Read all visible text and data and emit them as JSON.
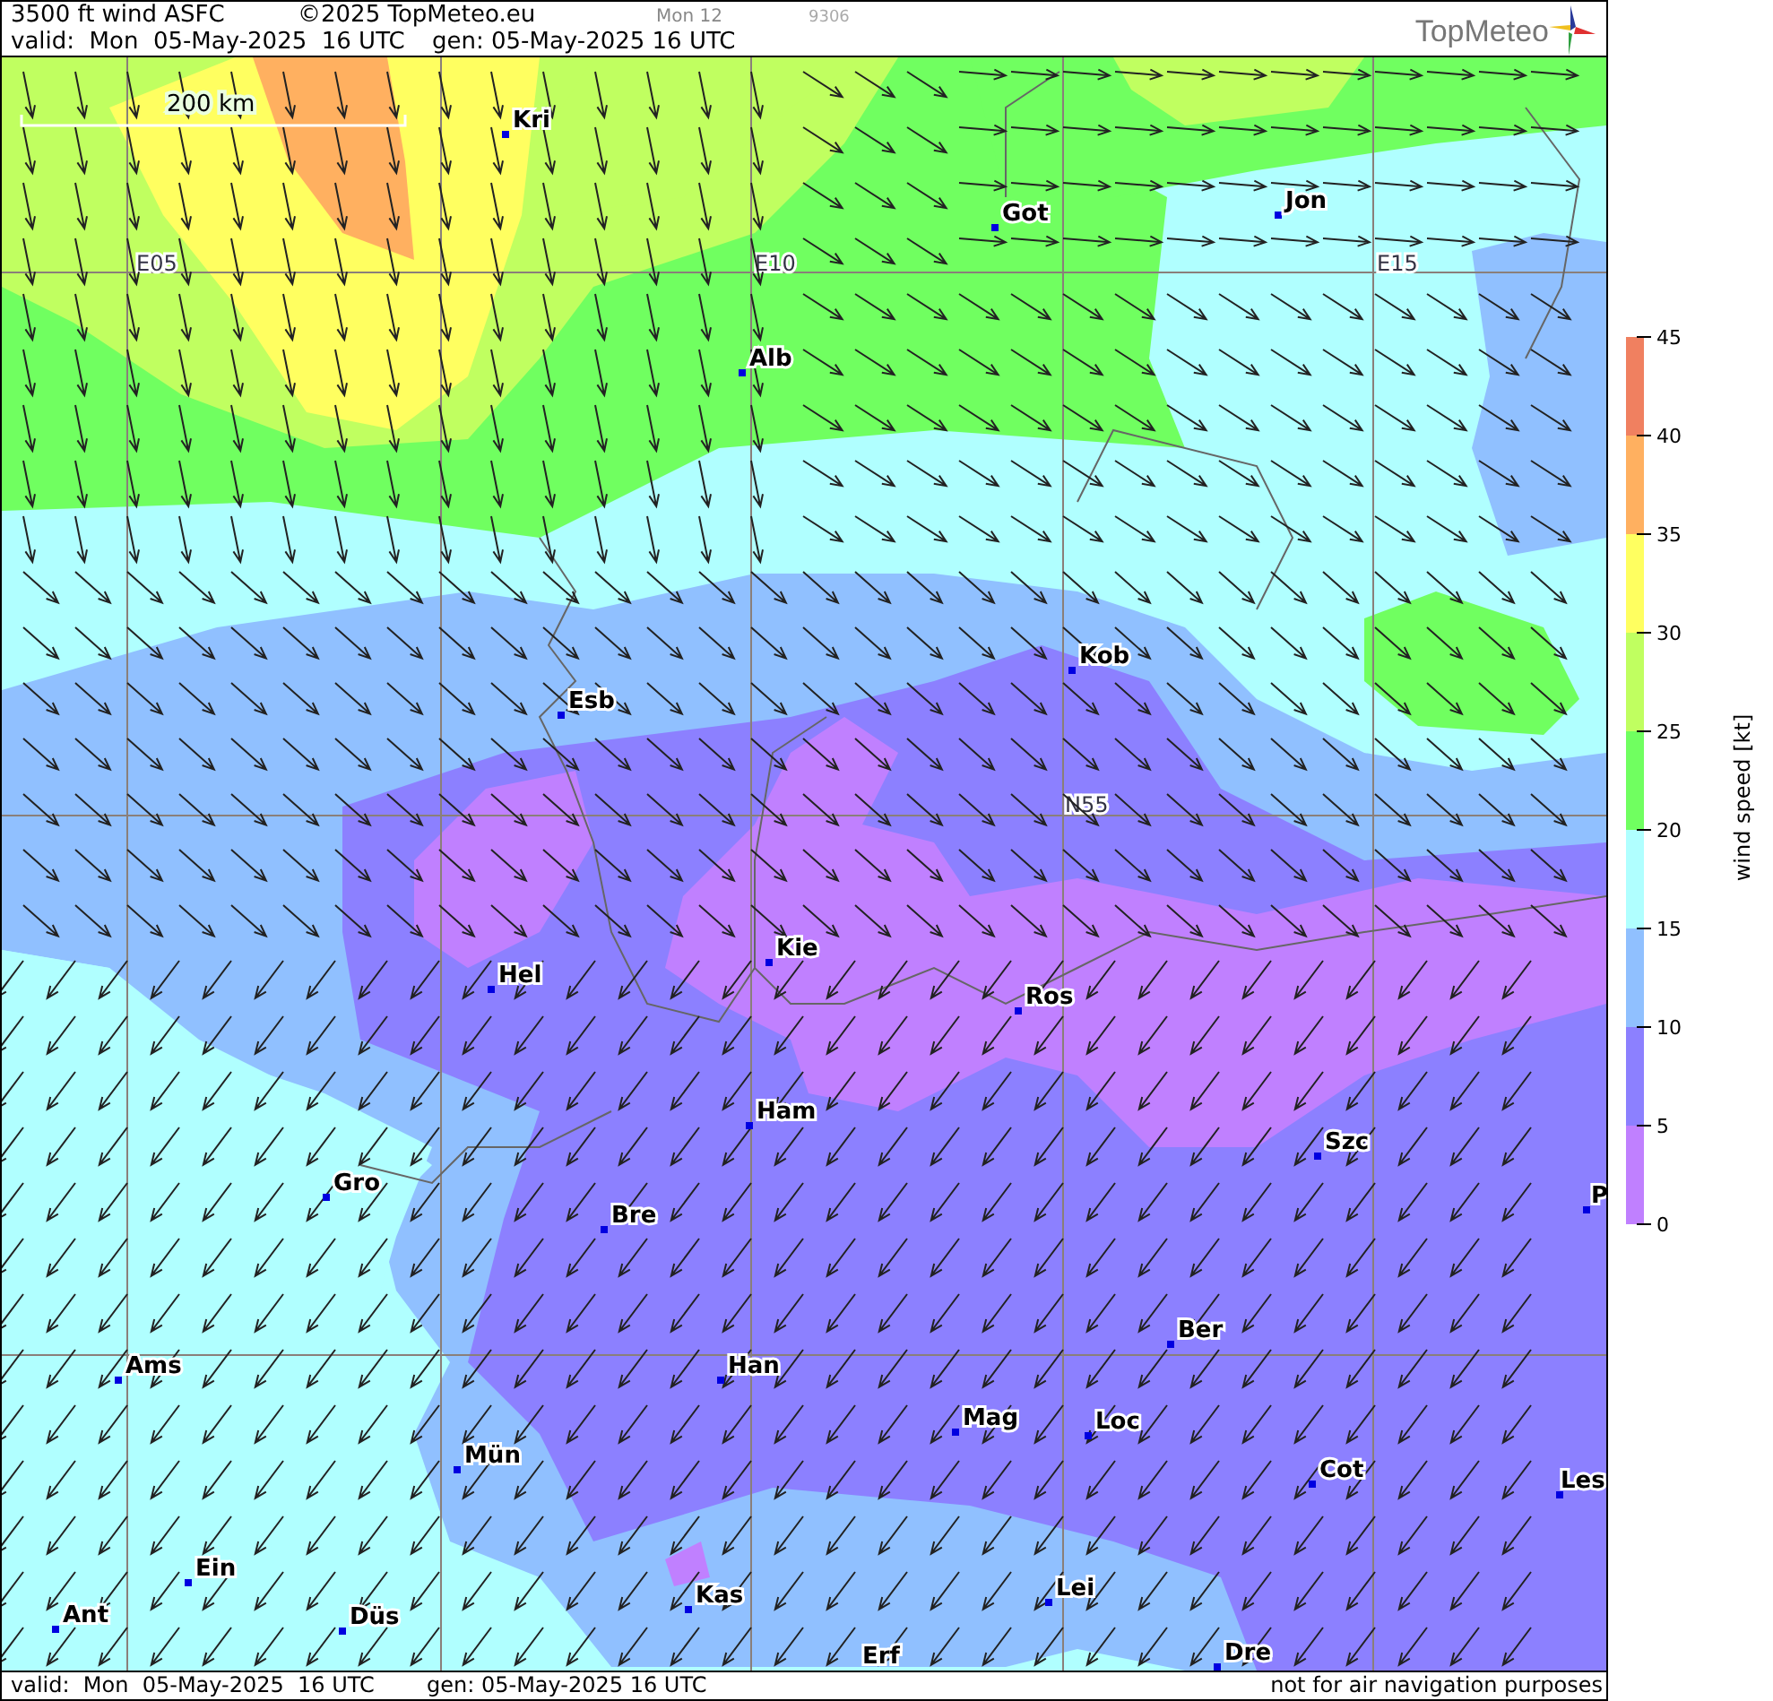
{
  "header": {
    "title": "3500 ft wind ASFC",
    "copyright": "©2025 TopMeteo.eu",
    "run_label": "Mon 12",
    "code": "9306",
    "valid": "valid:  Mon  05-May-2025  16 UTC",
    "generated": "gen: 05-May-2025 16 UTC",
    "logo": "TopMeteo"
  },
  "map": {
    "scale_bar": "200 km",
    "grid_labels": [
      "E05",
      "E10",
      "E15",
      "N55"
    ],
    "cities": [
      "Kri",
      "Got",
      "Jon",
      "Alb",
      "Kob",
      "Esb",
      "Kie",
      "Hel",
      "Ros",
      "Ham",
      "Szc",
      "Gro",
      "P",
      "Bre",
      "Ber",
      "Ams",
      "Han",
      "Mag",
      "Loc",
      "Mün",
      "Cot",
      "Les",
      "Ein",
      "Kas",
      "Lei",
      "Ant",
      "Düs",
      "Dre",
      "Erf"
    ]
  },
  "legend": {
    "title": "wind speed [kt]",
    "ticks": [
      "45",
      "40",
      "35",
      "30",
      "25",
      "20",
      "15",
      "10",
      "5",
      "0"
    ],
    "bands": [
      {
        "color": "#f08060"
      },
      {
        "color": "#ffb060"
      },
      {
        "color": "#ffff60"
      },
      {
        "color": "#c0ff60"
      },
      {
        "color": "#70ff60"
      },
      {
        "color": "#b0ffff"
      },
      {
        "color": "#90c0ff"
      },
      {
        "color": "#8c80ff"
      },
      {
        "color": "#c080ff"
      }
    ]
  },
  "footer": {
    "valid": "valid:  Mon  05-May-2025  16 UTC",
    "generated": "gen: 05-May-2025 16 UTC",
    "disclaimer": "not for air navigation purposes"
  }
}
